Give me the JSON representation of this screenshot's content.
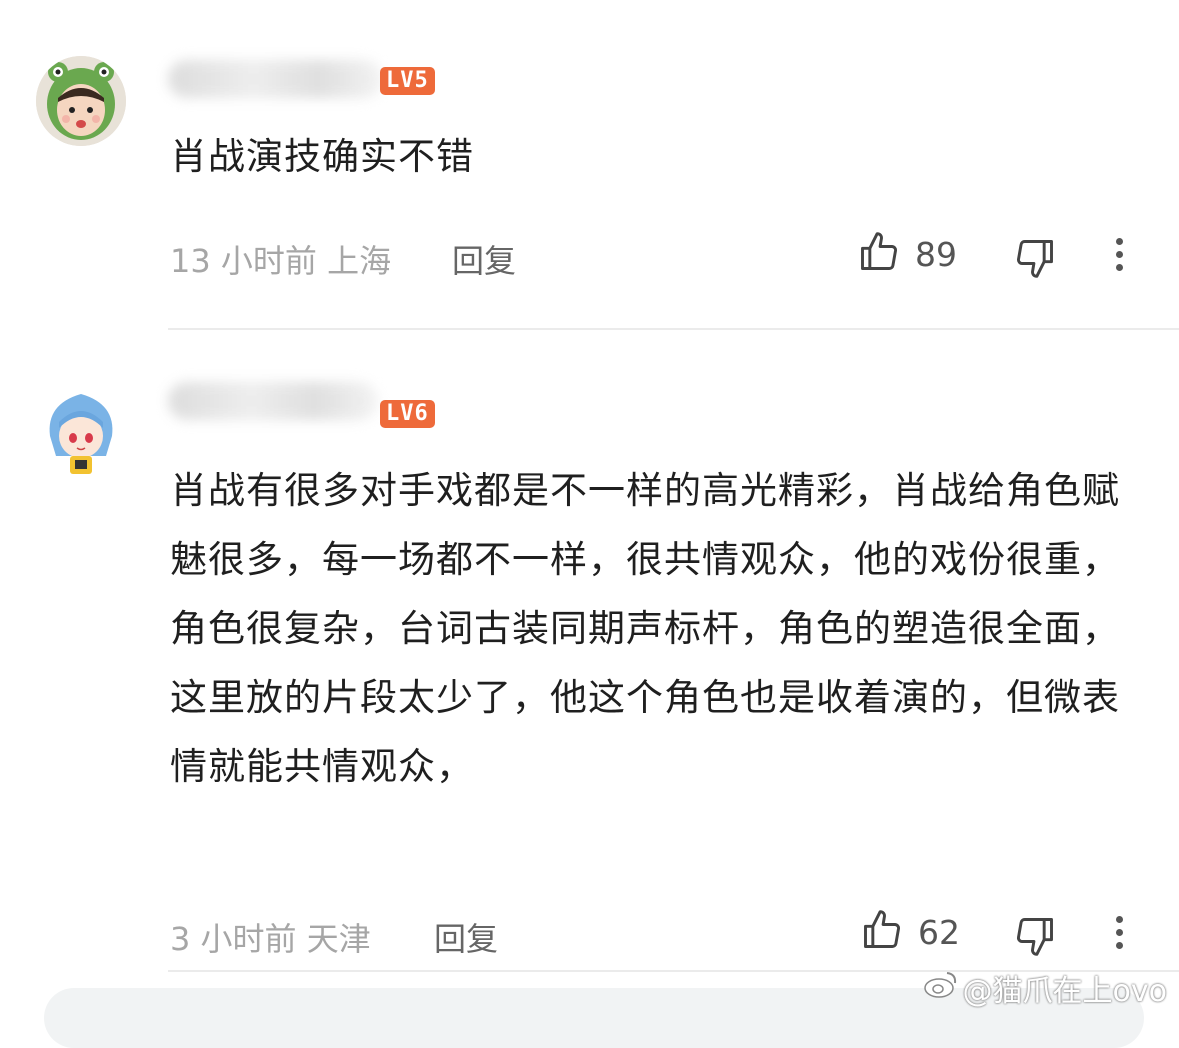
{
  "comments": [
    {
      "level_badge": "LV5",
      "text": "肖战演技确实不错",
      "meta": "13 小时前 上海",
      "reply_label": "回复",
      "likes": "89"
    },
    {
      "level_badge": "LV6",
      "text": "肖战有很多对手戏都是不一样的高光精彩，肖战给角色赋魅很多，每一场都不一样，很共情观众，他的戏份很重，角色很复杂，台词古装同期声标杆，角色的塑造很全面，这里放的片段太少了，他这个角色也是收着演的，但微表情就能共情观众，",
      "meta": "3 小时前 天津",
      "reply_label": "回复",
      "likes": "62"
    }
  ],
  "watermark": "@猫爪在上ovo",
  "colors": {
    "level_badge": "#ee6a3a",
    "meta_text": "#a6a6a6",
    "divider": "#ebebeb"
  }
}
